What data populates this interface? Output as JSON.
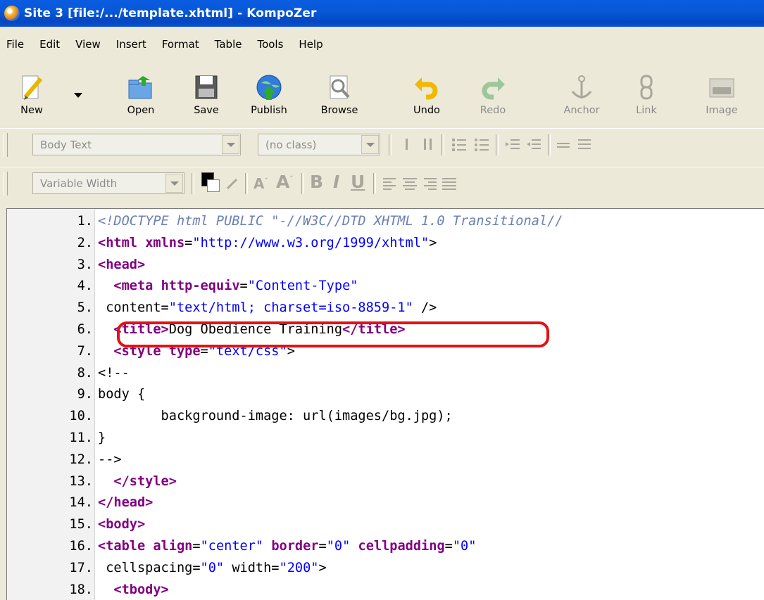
{
  "window": {
    "title": "Site 3 [file:/.../template.xhtml] - KompoZer"
  },
  "menu": [
    "File",
    "Edit",
    "View",
    "Insert",
    "Format",
    "Table",
    "Tools",
    "Help"
  ],
  "toolbar": {
    "new": "New",
    "open": "Open",
    "save": "Save",
    "publish": "Publish",
    "browse": "Browse",
    "undo": "Undo",
    "redo": "Redo",
    "anchor": "Anchor",
    "link": "Link",
    "image": "Image"
  },
  "format1": {
    "paragraph_style": "Body Text",
    "class": "(no class)"
  },
  "format2": {
    "font": "Variable Width",
    "bold": "B",
    "italic": "I",
    "underline": "U"
  },
  "editor": {
    "lines": [
      {
        "n": "1.",
        "parts": [
          {
            "k": "c",
            "s": "<!DOCTYPE html PUBLIC \"-//W3C//DTD XHTML 1.0 Transitional//"
          }
        ]
      },
      {
        "n": "2.",
        "parts": [
          {
            "k": "t",
            "s": "<html"
          },
          {
            "k": "p",
            "s": " "
          },
          {
            "k": "t",
            "s": "xmlns"
          },
          {
            "k": "p",
            "s": "="
          },
          {
            "k": "v",
            "s": "\"http://www.w3.org/1999/xhtml\""
          },
          {
            "k": "p",
            "s": ">"
          }
        ]
      },
      {
        "n": "3.",
        "parts": [
          {
            "k": "t",
            "s": "<head>"
          }
        ]
      },
      {
        "n": "4.",
        "parts": [
          {
            "k": "p",
            "s": "  "
          },
          {
            "k": "t",
            "s": "<meta"
          },
          {
            "k": "p",
            "s": " "
          },
          {
            "k": "t",
            "s": "http-equiv"
          },
          {
            "k": "p",
            "s": "="
          },
          {
            "k": "v",
            "s": "\"Content-Type\""
          }
        ]
      },
      {
        "n": "5.",
        "parts": [
          {
            "k": "p",
            "s": " content="
          },
          {
            "k": "v",
            "s": "\"text/html; charset=iso-8859-1\""
          },
          {
            "k": "p",
            "s": " />"
          }
        ]
      },
      {
        "n": "6.",
        "parts": [
          {
            "k": "p",
            "s": "  "
          },
          {
            "k": "t",
            "s": "<title>"
          },
          {
            "k": "p",
            "s": "Dog Obedience Training"
          },
          {
            "k": "t",
            "s": "</title>"
          }
        ]
      },
      {
        "n": "7.",
        "parts": [
          {
            "k": "p",
            "s": "  "
          },
          {
            "k": "t",
            "s": "<style"
          },
          {
            "k": "p",
            "s": " "
          },
          {
            "k": "t",
            "s": "type"
          },
          {
            "k": "p",
            "s": "="
          },
          {
            "k": "v",
            "s": "\"text/css\""
          },
          {
            "k": "p",
            "s": ">"
          }
        ]
      },
      {
        "n": "8.",
        "parts": [
          {
            "k": "p",
            "s": "<!--"
          }
        ]
      },
      {
        "n": "9.",
        "parts": [
          {
            "k": "p",
            "s": "body {"
          }
        ]
      },
      {
        "n": "10.",
        "parts": [
          {
            "k": "p",
            "s": "        background-image: url(images/bg.jpg);"
          }
        ]
      },
      {
        "n": "11.",
        "parts": [
          {
            "k": "p",
            "s": "}"
          }
        ]
      },
      {
        "n": "12.",
        "parts": [
          {
            "k": "p",
            "s": "-->"
          }
        ]
      },
      {
        "n": "13.",
        "parts": [
          {
            "k": "p",
            "s": "  "
          },
          {
            "k": "t",
            "s": "</style>"
          }
        ]
      },
      {
        "n": "14.",
        "parts": [
          {
            "k": "t",
            "s": "</head>"
          }
        ]
      },
      {
        "n": "15.",
        "parts": [
          {
            "k": "t",
            "s": "<body>"
          }
        ]
      },
      {
        "n": "16.",
        "parts": [
          {
            "k": "t",
            "s": "<table"
          },
          {
            "k": "p",
            "s": " "
          },
          {
            "k": "t",
            "s": "align"
          },
          {
            "k": "p",
            "s": "="
          },
          {
            "k": "v",
            "s": "\"center\""
          },
          {
            "k": "p",
            "s": " "
          },
          {
            "k": "t",
            "s": "border"
          },
          {
            "k": "p",
            "s": "="
          },
          {
            "k": "v",
            "s": "\"0\""
          },
          {
            "k": "p",
            "s": " "
          },
          {
            "k": "t",
            "s": "cellpadding"
          },
          {
            "k": "p",
            "s": "="
          },
          {
            "k": "v",
            "s": "\"0\""
          }
        ]
      },
      {
        "n": "17.",
        "parts": [
          {
            "k": "p",
            "s": " cellspacing="
          },
          {
            "k": "v",
            "s": "\"0\""
          },
          {
            "k": "p",
            "s": " width="
          },
          {
            "k": "v",
            "s": "\"200\""
          },
          {
            "k": "p",
            "s": ">"
          }
        ]
      },
      {
        "n": "18.",
        "parts": [
          {
            "k": "p",
            "s": "  "
          },
          {
            "k": "t",
            "s": "<tbody>"
          }
        ]
      }
    ]
  }
}
